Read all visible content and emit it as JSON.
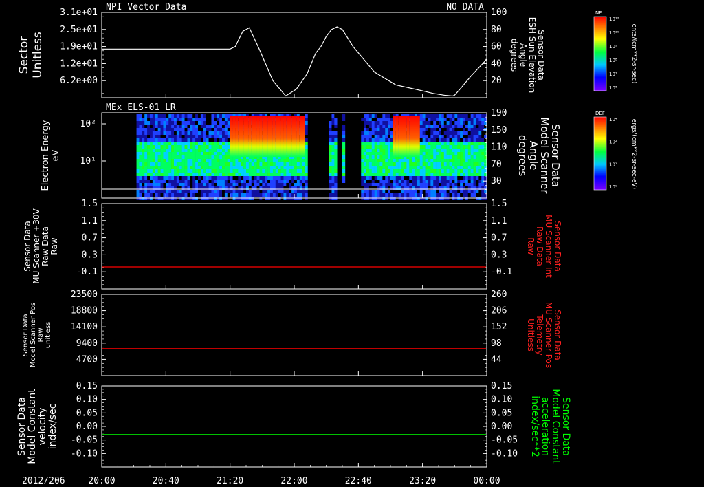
{
  "date_label": "2012/206",
  "time_ticks": [
    "20:00",
    "20:40",
    "21:20",
    "22:00",
    "22:40",
    "23:20",
    "00:00"
  ],
  "chart_data": [
    {
      "type": "line",
      "title": "NPI Vector Data",
      "status": "NO DATA",
      "ylabel_left": [
        "Sector",
        "Unitless"
      ],
      "ylabel_right": [
        "Sensor Data",
        "ESH Sun Elevation",
        "Angle",
        "degrees"
      ],
      "left_ticks": [
        "3.1e+01",
        "2.5e+01",
        "1.9e+01",
        "1.2e+01",
        "6.2e+00"
      ],
      "right_ticks": [
        "100",
        "80",
        "60",
        "40",
        "20"
      ],
      "ylim_right": [
        0,
        100
      ],
      "series": [
        {
          "axis": "right",
          "x_minutes": [
            0,
            80,
            100,
            120,
            125,
            128,
            132,
            138,
            148,
            160,
            172,
            182,
            192,
            200,
            205,
            210,
            215,
            220,
            225,
            235,
            255,
            275,
            300,
            310,
            320,
            328,
            330,
            335,
            345,
            360
          ],
          "y": [
            57,
            57,
            57,
            57,
            60,
            68,
            78,
            82,
            55,
            20,
            2,
            10,
            28,
            52,
            60,
            72,
            80,
            83,
            80,
            60,
            30,
            15,
            8,
            5,
            3,
            2,
            3,
            10,
            25,
            45
          ]
        }
      ]
    },
    {
      "type": "heatmap",
      "title": "MEx ELS-01 LR",
      "ylabel_left": [
        "Electron Energy",
        "eV"
      ],
      "ylabel_right": [
        "Sensor Data",
        "Model Scanner",
        "Angle",
        "degrees"
      ],
      "left_ticks": [
        "10²",
        "10¹"
      ],
      "right_ticks": [
        "190",
        "150",
        "110",
        "70",
        "30"
      ],
      "colorbar": {
        "label": "DEF",
        "units": "ergs/(cm**2-sr-sec-eV)",
        "ticks": [
          "10⁴",
          "10²",
          "10¹",
          "10⁰"
        ]
      },
      "gaps_minutes": [
        [
          0,
          32
        ],
        [
          192,
          212
        ],
        [
          218,
          223
        ],
        [
          227,
          242
        ]
      ],
      "hot_bands_minutes": [
        [
          120,
          190
        ],
        [
          272,
          297
        ]
      ],
      "line_value": 15
    },
    {
      "type": "line",
      "ylabel_left": [
        "Sensor Data",
        "MU Scanner +30V",
        "Raw Data",
        "Raw"
      ],
      "ylabel_right": [
        "Sensor Data",
        "MU Scanner Int",
        "Raw Data",
        "Raw"
      ],
      "ticks": [
        "1.5",
        "1.1",
        "0.7",
        "0.3",
        "-0.1"
      ],
      "ylim": [
        -0.5,
        1.5
      ],
      "series": [
        {
          "color": "#ff0000",
          "y_constant": 0.0
        }
      ]
    },
    {
      "type": "line",
      "ylabel_left": [
        "Sensor Data",
        "Model Scanner Pos",
        "Raw",
        "unitless"
      ],
      "ylabel_right": [
        "Sensor Data",
        "MU Scanner Pos",
        "Telemetry",
        "Unitless"
      ],
      "left_ticks": [
        "23500",
        "18800",
        "14100",
        "9400",
        "4700"
      ],
      "right_ticks": [
        "260",
        "206",
        "152",
        "98",
        "44"
      ],
      "ylim_left": [
        0,
        23500
      ],
      "series": [
        {
          "color": "#ff0000",
          "y_constant": 8000
        }
      ]
    },
    {
      "type": "line",
      "ylabel_left": [
        "Sensor Data",
        "Model Constant",
        "velocity",
        "index/sec"
      ],
      "ylabel_right": [
        "Sensor Data",
        "Model Constant",
        "acceleration",
        "index/sec**2"
      ],
      "ticks": [
        "0.15",
        "0.10",
        "0.05",
        "0.00",
        "-0.05",
        "-0.10"
      ],
      "ylim": [
        -0.1,
        0.15
      ],
      "series": [
        {
          "color": "#00ff00",
          "y_constant": 0.0
        }
      ]
    }
  ],
  "colorbar_top": {
    "label": "NF",
    "units": "cnts/(cm**2-sr-sec)",
    "ticks": [
      "10¹²",
      "10¹⁰",
      "10⁹",
      "10⁸",
      "10⁷",
      "10⁶"
    ]
  }
}
